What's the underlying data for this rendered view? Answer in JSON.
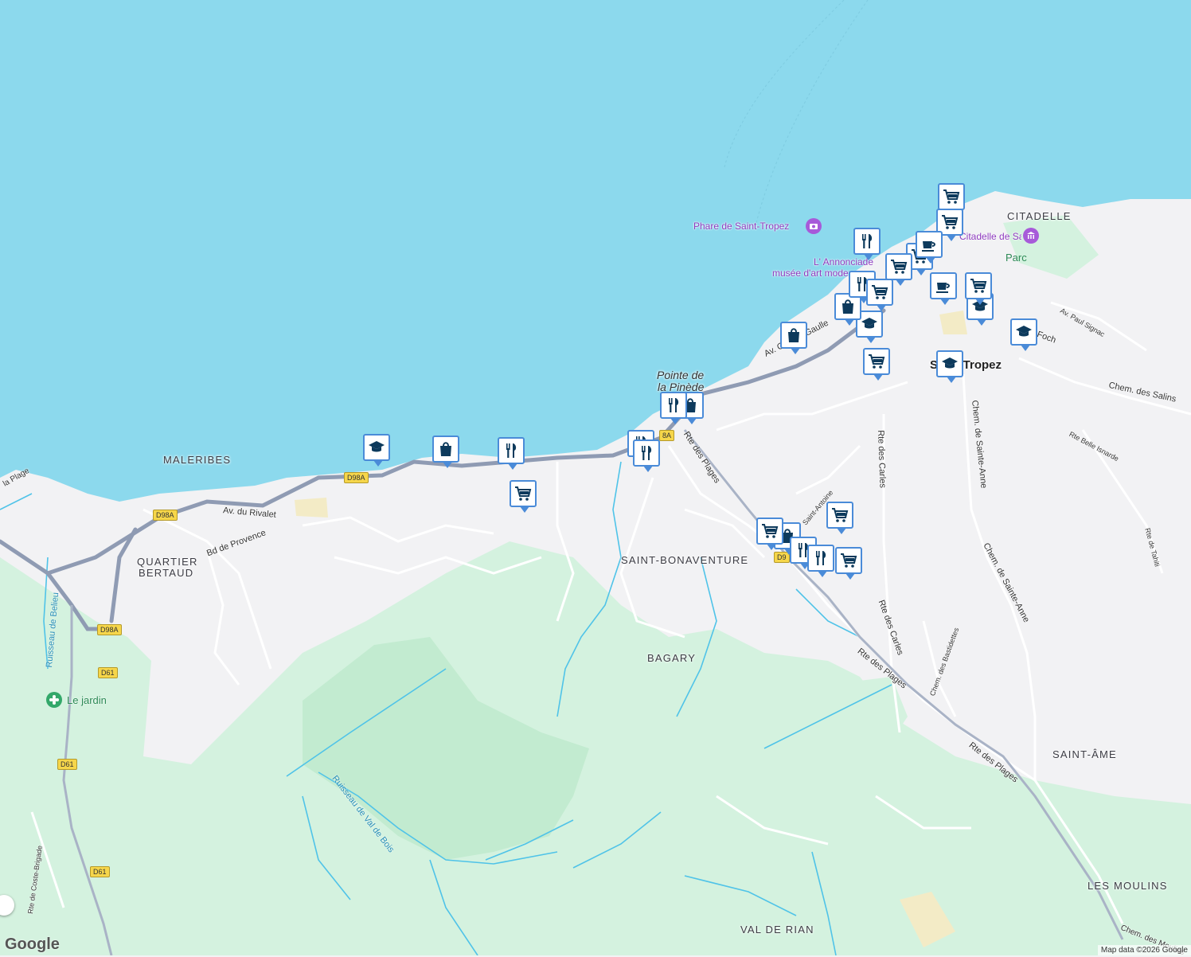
{
  "colors": {
    "sea": "#8cd9ed",
    "land": "#f2f2f4",
    "forest": "#d4f2df",
    "forest_dark": "#c2ebd0",
    "road_major": "#8f9bb3",
    "road_minor": "#ffffff",
    "stream": "#4fc3e8",
    "pin_fill": "#0d3a5c",
    "pin_border": "#4a8bd8",
    "poi_purple": "#a75ad9",
    "park_green": "#33a86a"
  },
  "areas": {
    "malerbes": "MALERIBES",
    "quartier_bertaud_1": "QUARTIER",
    "quartier_bertaud_2": "BERTAUD",
    "saint_bonaventure": "SAINT-BONAVENTURE",
    "bagary": "BAGARY",
    "citadelle": "CITADELLE",
    "saint_ame": "SAINT-ÂME",
    "les_moulins": "LES MOULINS",
    "val_de_rian": "VAL DE RIAN"
  },
  "places": {
    "pointe_1": "Pointe de",
    "pointe_2": "la Pinède",
    "saint_tropez": "Saint-Tropez",
    "parc": "Parc",
    "le_jardin": "Le jardin"
  },
  "pois": {
    "phare": "Phare de Saint-Tropez",
    "annonciade_1": "L' Annonciade",
    "annonciade_2": "musée d'art moderne",
    "citadelle_musee": "Citadelle de Saint-Tropez - Musée d'histoire maritime"
  },
  "streets": {
    "av_gen_gaulle": "Av. Gén de Gaulle",
    "rte_des_plages_1": "Rte des Plages",
    "rte_des_plages_2": "Rte des Plages",
    "rte_des_plages_3": "Rte des Plages",
    "av_rivalet": "Av. du Rivalet",
    "bd_provence": "Bd de Provence",
    "rte_des_carles_1": "Rte des Carles",
    "rte_des_carles_2": "Rte des Carles",
    "chem_sainte_anne_1": "Chem. de Sainte-Anne",
    "chem_sainte_anne_2": "Chem. de Sainte-Anne",
    "chem_salins": "Chem. des Salins",
    "av_paul_signac": "Av. Paul Signac",
    "foch": "Foch",
    "rte_belle_isnarde": "Rte Belle Isnarde",
    "rte_tahiti": "Rte de Tahiti",
    "chem_bastidettes": "Chem. des Bastidettes",
    "saint_antoine": "Saint-Antoine",
    "rte_coste_brigade": "Rte de Coste-Brigade",
    "chem_moulins": "Chem. des Moulins",
    "la_plage": "la Plage",
    "ruisseau_belieu": "Ruisseau de Belieu",
    "ruisseau_val_bois": "Ruisseau de Val de Bois"
  },
  "shields": {
    "d98a_1": "D98A",
    "d98a_2": "D98A",
    "d98a_3": "D98A",
    "d61_1": "D61",
    "d61_2": "D61",
    "d61_3": "D61",
    "d98a_4": "8A",
    "d98a_5": "D9"
  },
  "footer": {
    "logo": "Google",
    "attribution": "Map data ©2026 Google"
  },
  "markers": [
    {
      "type": "school",
      "name": "school-marker"
    },
    {
      "type": "shopping",
      "name": "shopping-marker"
    },
    {
      "type": "restaurant",
      "name": "restaurant-marker"
    },
    {
      "type": "grocery",
      "name": "grocery-marker"
    }
  ]
}
